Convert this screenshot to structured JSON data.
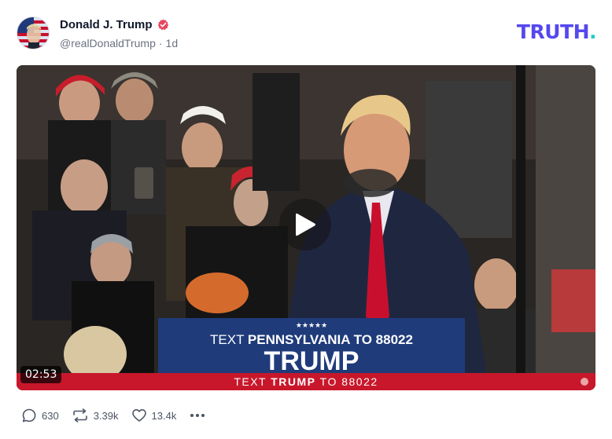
{
  "author": {
    "display_name": "Donald J. Trump",
    "handle": "@realDonaldTrump",
    "separator": "·",
    "time_ago": "1d",
    "verified": true
  },
  "brand": {
    "logo_text": "TRUTH",
    "logo_dot": ".",
    "logo_color": "#5448ee",
    "dot_color": "#1fd0bf"
  },
  "media": {
    "type": "video",
    "duration": "02:53",
    "play_icon": "play-icon",
    "podium_stars": "★★★★★",
    "podium_line1_a": "TEXT ",
    "podium_line1_b": "PENNSYLVANIA",
    "podium_line1_c": " TO 88022",
    "podium_line2": "TRUMP",
    "banner_a": "TEXT ",
    "banner_b": "TRUMP",
    "banner_c": " TO 88022"
  },
  "actions": {
    "replies": "630",
    "retruths": "3.39k",
    "likes": "13.4k"
  }
}
